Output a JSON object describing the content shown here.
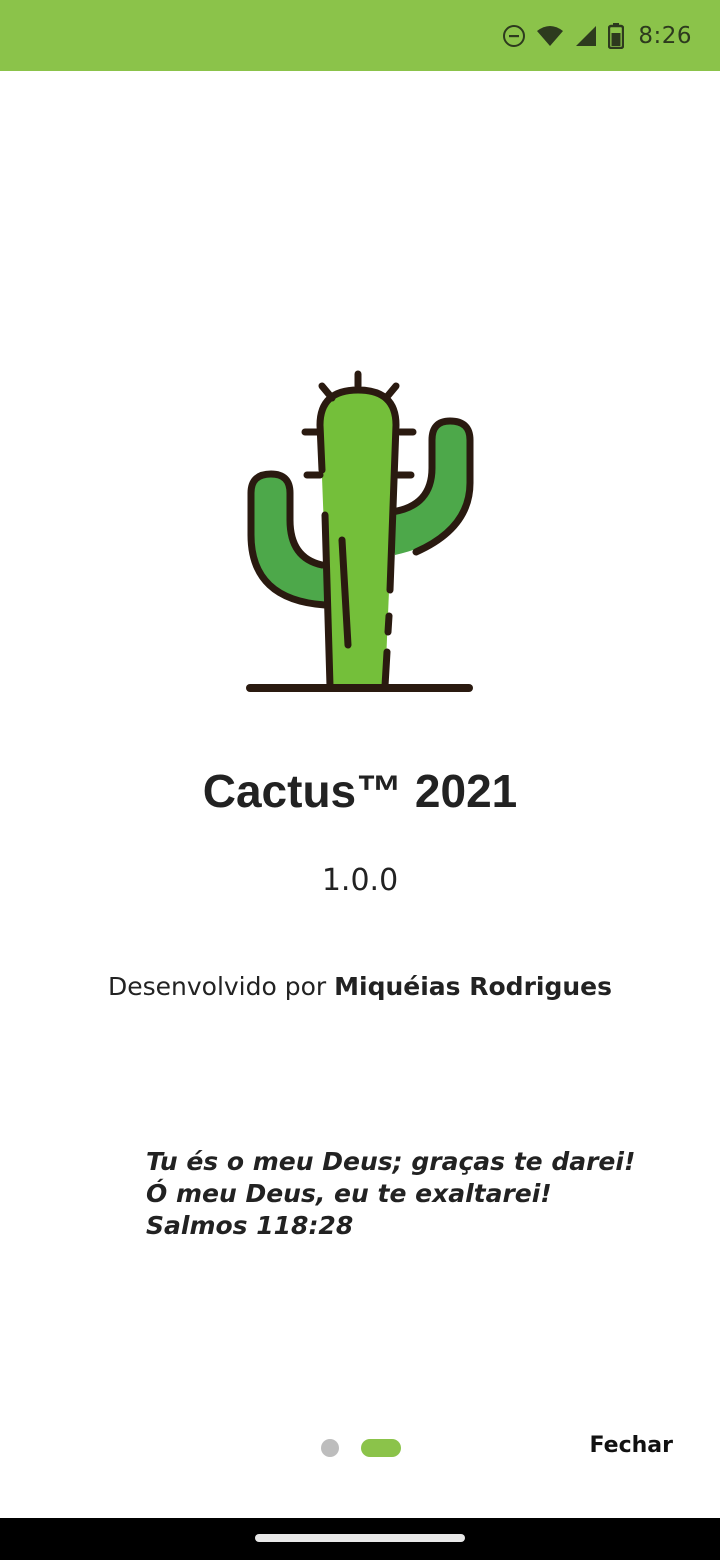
{
  "status_bar": {
    "time": "8:26",
    "icons": [
      "do-not-disturb-icon",
      "wifi-icon",
      "cellular-signal-icon",
      "battery-icon"
    ],
    "background_color": "#8bc34a"
  },
  "about": {
    "app_title": "Cactus™ 2021",
    "version": "1.0.0",
    "developed_by_label": "Desenvolvido por",
    "developer_name": "Miquéias Rodrigues",
    "verse": {
      "line1": "Tu és o meu Deus; graças te darei!",
      "line2": "Ó meu Deus, eu te exaltarei!",
      "reference": "Salmos 118:28"
    }
  },
  "footer": {
    "page_count": 2,
    "current_page": 2,
    "close_label": "Fechar",
    "accent_color": "#8bc34a",
    "inactive_dot_color": "#bdbdbd"
  }
}
